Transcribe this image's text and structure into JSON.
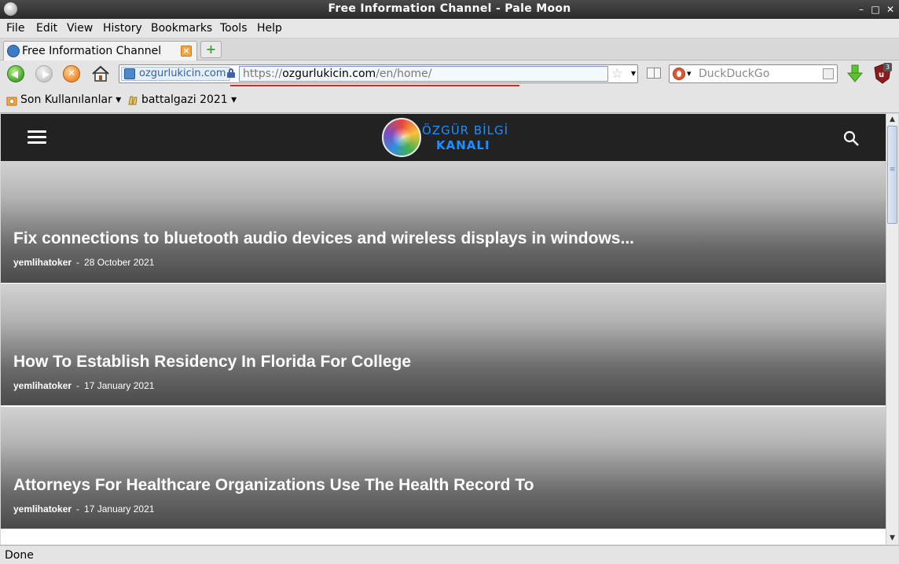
{
  "window": {
    "title": "Free Information Channel - Pale Moon"
  },
  "menu": {
    "file": "File",
    "edit": "Edit",
    "view": "View",
    "history": "History",
    "bookmarks": "Bookmarks",
    "tools": "Tools",
    "help": "Help"
  },
  "tabs": [
    {
      "label": "Free Information Channel",
      "active": true
    }
  ],
  "url": {
    "identity": "ozgurlukicin.com",
    "scheme": "https://",
    "host": "ozgurlukicin.com",
    "path": "/en/home/"
  },
  "search": {
    "placeholder": "DuckDuckGo"
  },
  "toolbar": {
    "ublock_count": "3"
  },
  "bookmarks": [
    {
      "label": "Son Kullanılanlar"
    },
    {
      "label": "battalgazi 2021"
    }
  ],
  "site": {
    "logo_line1": "ÖZGÜR BİLGİ",
    "logo_line2": "KANALI",
    "posts": [
      {
        "title": "Fix connections to bluetooth audio devices and wireless displays in windows...",
        "author": "yemlihatoker",
        "separator": "-",
        "date": "28 October 2021"
      },
      {
        "title": "How To Establish Residency In Florida For College",
        "author": "yemlihatoker",
        "separator": "-",
        "date": "17 January 2021"
      },
      {
        "title": "Attorneys For Healthcare Organizations Use The Health Record To",
        "author": "yemlihatoker",
        "separator": "-",
        "date": "17 January 2021"
      }
    ]
  },
  "status": {
    "text": "Done"
  },
  "colors": {
    "accent_logo": "#1f8fff",
    "site_header": "#222222",
    "url_underline": "#e02424"
  }
}
